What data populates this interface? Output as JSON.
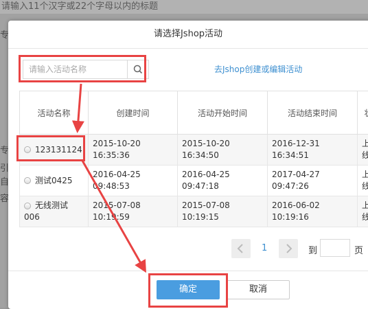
{
  "background": {
    "top_hint": "请输入11个汉字或22个字母以内的标题",
    "side_chars": [
      "专",
      "专",
      "引",
      "自",
      "容"
    ]
  },
  "modal": {
    "title": "请选择Jshop活动",
    "search": {
      "placeholder": "请输入活动名称",
      "value": ""
    },
    "link": "去Jshop创建或编辑活动",
    "table": {
      "headers": [
        "活动名称",
        "创建时间",
        "活动开始时间",
        "活动结束时间",
        "状"
      ],
      "rows": [
        {
          "name": "123131124",
          "created": [
            "2015-10-20",
            "16:35:36"
          ],
          "start": [
            "2015-10-20",
            "16:34:50"
          ],
          "end": [
            "2016-12-31",
            "16:34:51"
          ],
          "status": [
            "上",
            "线"
          ]
        },
        {
          "name": "测试0425",
          "created": [
            "2016-04-25",
            "09:48:53"
          ],
          "start": [
            "2016-04-25",
            "09:47:18"
          ],
          "end": [
            "2017-04-27",
            "09:47:26"
          ],
          "status": [
            "上",
            "线"
          ]
        },
        {
          "name": "无线测试006",
          "name_lines": [
            "无线测试",
            "006"
          ],
          "created": [
            "2015-07-08",
            "10:19:59"
          ],
          "start": [
            "2015-07-08",
            "10:19:15"
          ],
          "end": [
            "2016-06-02",
            "10:19:16"
          ],
          "status": [
            "上",
            "线"
          ]
        }
      ]
    },
    "pager": {
      "page": "1",
      "goto_label": "到",
      "page_unit": "页",
      "goto_value": ""
    },
    "buttons": {
      "ok": "确定",
      "cancel": "取消"
    },
    "colors": {
      "accent": "#4a9de0",
      "highlight": "#e84343",
      "link": "#3d8fd0"
    }
  }
}
